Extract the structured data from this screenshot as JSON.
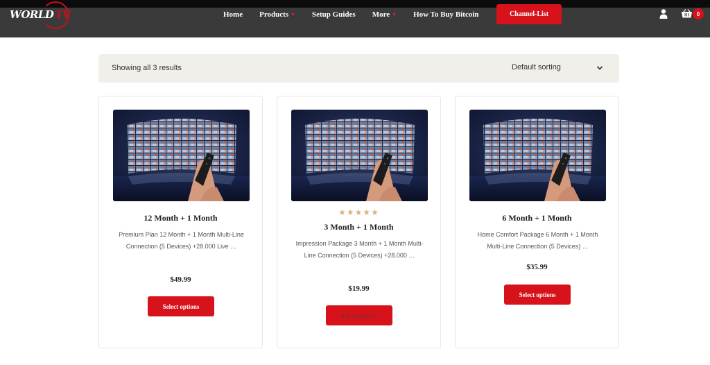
{
  "header": {
    "logo_text": "WORLD",
    "logo_accent": "TV",
    "nav": [
      {
        "label": "Home",
        "has_dropdown": false
      },
      {
        "label": "Products",
        "has_dropdown": true
      },
      {
        "label": "Setup Guides",
        "has_dropdown": false
      },
      {
        "label": "More",
        "has_dropdown": true
      },
      {
        "label": "How To Buy Bitcoin",
        "has_dropdown": false
      }
    ],
    "channel_button": "Channel-List",
    "user_icon": "user-icon",
    "cart_icon": "basket-icon",
    "cart_count": "0"
  },
  "shop": {
    "result_count": "Showing all 3 results",
    "sort_selected": "Default sorting",
    "sort_icon": "chevron-down-icon"
  },
  "products": [
    {
      "title": "12 Month + 1 Month",
      "rating": "",
      "description": "Premium Plan 12 Month + 1 Month Multi-Line Connection (5 Devices) +28.000 Live …",
      "price": "$49.99",
      "button": "Select options"
    },
    {
      "title": "3 Month + 1 Month",
      "rating": "★★★★★",
      "description": "Impression Package 3 Month + 1 Month Multi-Line Connection (5 Devices) +28.000 …",
      "price": "$19.99",
      "button": "Select options"
    },
    {
      "title": "6 Month + 1 Month",
      "rating": "",
      "description": "Home Comfort Package 6 Month + 1 Month Multi-Line Connection (5 Devices) …",
      "price": "$35.99",
      "button": "Select options"
    }
  ],
  "colors": {
    "header_bg": "#3a3a3a",
    "accent_red": "#d7121b",
    "sort_bar_bg": "#f1efea",
    "star_color": "#d8b27a"
  }
}
